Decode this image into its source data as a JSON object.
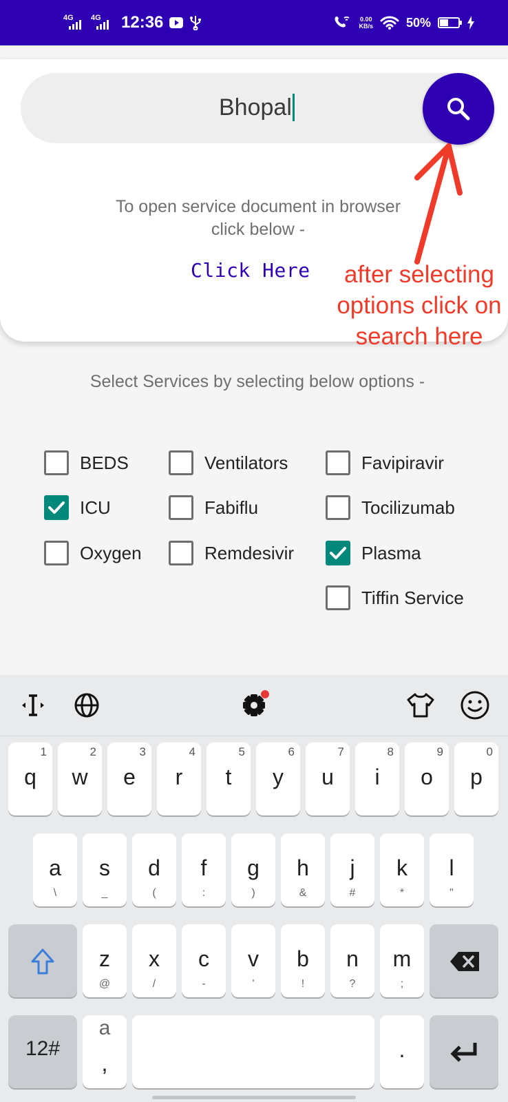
{
  "status_bar": {
    "network_1": "4G",
    "network_2": "4G",
    "time": "12:36",
    "net_speed_value": "0.00",
    "net_speed_unit": "KB/s",
    "battery_percent": "50%",
    "battery_level": 0.5
  },
  "search": {
    "value": "Bhopal",
    "icon": "search-icon"
  },
  "info": {
    "text": "To open service document in browser click below -",
    "link_label": "Click Here"
  },
  "annotation": {
    "text": "after selecting options click on search here",
    "color": "#f03a2a"
  },
  "services": {
    "prompt": "Select Services by selecting below options -",
    "options": [
      {
        "label": "BEDS",
        "checked": false
      },
      {
        "label": "Ventilators",
        "checked": false
      },
      {
        "label": "Favipiravir",
        "checked": false
      },
      {
        "label": "ICU",
        "checked": true
      },
      {
        "label": "Fabiflu",
        "checked": false
      },
      {
        "label": "Tocilizumab",
        "checked": false
      },
      {
        "label": "Oxygen",
        "checked": false
      },
      {
        "label": "Remdesivir",
        "checked": false
      },
      {
        "label": "Plasma",
        "checked": true
      },
      {
        "label": "Tiffin Service",
        "checked": false
      }
    ]
  },
  "keyboard": {
    "row1": [
      {
        "key": "q",
        "hint": "1"
      },
      {
        "key": "w",
        "hint": "2"
      },
      {
        "key": "e",
        "hint": "3"
      },
      {
        "key": "r",
        "hint": "4"
      },
      {
        "key": "t",
        "hint": "5"
      },
      {
        "key": "y",
        "hint": "6"
      },
      {
        "key": "u",
        "hint": "7"
      },
      {
        "key": "i",
        "hint": "8"
      },
      {
        "key": "o",
        "hint": "9"
      },
      {
        "key": "p",
        "hint": "0"
      }
    ],
    "row2": [
      {
        "key": "a",
        "sub": "\\"
      },
      {
        "key": "s",
        "sub": "_"
      },
      {
        "key": "d",
        "sub": "("
      },
      {
        "key": "f",
        "sub": ":"
      },
      {
        "key": "g",
        "sub": ")"
      },
      {
        "key": "h",
        "sub": "&"
      },
      {
        "key": "j",
        "sub": "#"
      },
      {
        "key": "k",
        "sub": "*"
      },
      {
        "key": "l",
        "sub": "\""
      }
    ],
    "row3": [
      {
        "key": "z",
        "sub": "@"
      },
      {
        "key": "x",
        "sub": "/"
      },
      {
        "key": "c",
        "sub": "-"
      },
      {
        "key": "v",
        "sub": "'"
      },
      {
        "key": "b",
        "sub": "!"
      },
      {
        "key": "n",
        "sub": "?"
      },
      {
        "key": "m",
        "sub": ";"
      }
    ],
    "symbols_label": "12#",
    "comma_key_top": "a",
    "comma_key_bottom": ",",
    "period_key": ".",
    "accent_color": "#2f00b3"
  }
}
